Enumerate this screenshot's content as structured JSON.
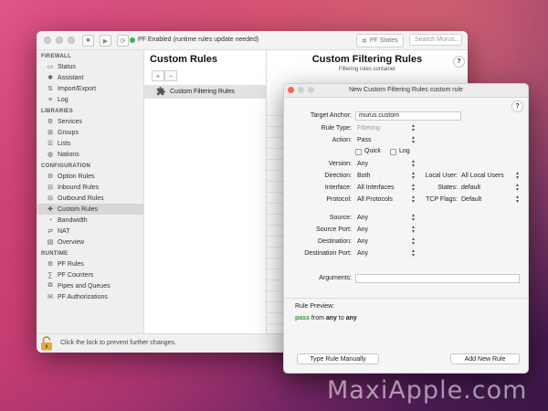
{
  "main_window": {
    "status_text": "PF Enabled (runtime rules update needed)",
    "pf_states_label": "PF States",
    "search_placeholder": "Search Murus...",
    "sidebar": {
      "sections": [
        {
          "title": "FIREWALL",
          "items": [
            {
              "label": "Status",
              "icon": "monitor-icon"
            },
            {
              "label": "Assistant",
              "icon": "assistant-icon"
            },
            {
              "label": "Import/Export",
              "icon": "import-export-icon"
            },
            {
              "label": "Log",
              "icon": "log-icon"
            }
          ]
        },
        {
          "title": "LIBRARIES",
          "items": [
            {
              "label": "Services",
              "icon": "services-icon"
            },
            {
              "label": "Groups",
              "icon": "groups-icon"
            },
            {
              "label": "Lists",
              "icon": "lists-icon"
            },
            {
              "label": "Nations",
              "icon": "nations-icon"
            }
          ]
        },
        {
          "title": "CONFIGURATION",
          "items": [
            {
              "label": "Option Rules",
              "icon": "option-rules-icon"
            },
            {
              "label": "Inbound Rules",
              "icon": "inbound-rules-icon"
            },
            {
              "label": "Outbound Rules",
              "icon": "outbound-rules-icon"
            },
            {
              "label": "Custom Rules",
              "icon": "custom-rules-icon",
              "active": true
            },
            {
              "label": "Bandwidth",
              "icon": "bandwidth-icon"
            },
            {
              "label": "NAT",
              "icon": "nat-icon"
            },
            {
              "label": "Overview",
              "icon": "overview-icon"
            }
          ]
        },
        {
          "title": "RUNTIME",
          "items": [
            {
              "label": "PF Rules",
              "icon": "pf-rules-icon"
            },
            {
              "label": "PF Counters",
              "icon": "pf-counters-icon"
            },
            {
              "label": "Pipes and Queues",
              "icon": "pipes-icon"
            },
            {
              "label": "PF Authorizations",
              "icon": "pf-auth-icon"
            }
          ]
        }
      ]
    },
    "custom_rules_title": "Custom Rules",
    "custom_rule_item": "Custom Filtering Rules",
    "detail_title": "Custom Filtering Rules",
    "detail_subtitle": "Filtering rules container",
    "lock_text": "Click the lock to prevent further changes."
  },
  "dialog": {
    "title": "New Custom Filtering Rules custom rule",
    "target_anchor_label": "Target Anchor:",
    "target_anchor_value": "murus.custom",
    "rule_type_label": "Rule Type:",
    "rule_type_value": "Filtering",
    "action_label": "Action:",
    "action_value": "Pass",
    "quick_label": "Quick",
    "log_label": "Log",
    "version_label": "Version:",
    "version_value": "Any",
    "direction_label": "Direction:",
    "direction_value": "Both",
    "local_user_label": "Local User:",
    "local_user_value": "All Local Users",
    "interface_label": "Interface:",
    "interface_value": "All Interfaces",
    "states_label": "States:",
    "states_value": "default",
    "protocol_label": "Protocol:",
    "protocol_value": "All Protocols",
    "tcp_flags_label": "TCP Flags:",
    "tcp_flags_value": "Default",
    "source_label": "Source:",
    "source_value": "Any",
    "source_port_label": "Source Port:",
    "source_port_value": "Any",
    "destination_label": "Destination:",
    "destination_value": "Any",
    "destination_port_label": "Destination Port:",
    "destination_port_value": "Any",
    "arguments_label": "Arguments:",
    "arguments_value": "",
    "rule_preview_label": "Rule Preview:",
    "preview_pass": "pass",
    "preview_from": "from",
    "preview_any1": "any",
    "preview_to": "to",
    "preview_any2": "any",
    "type_manually_button": "Type Rule Manually",
    "add_new_rule_button": "Add New Rule"
  },
  "watermark": "MaxiApple.com"
}
